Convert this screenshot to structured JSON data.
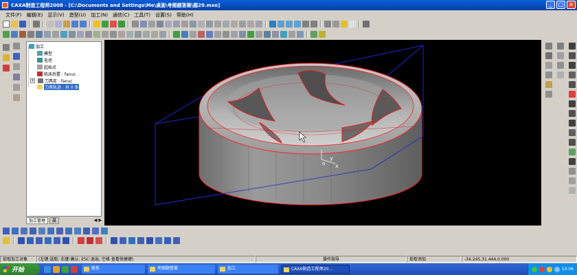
{
  "window": {
    "title": "CAXA制造工程师2008  - [C:\\Documents and Settings\\Me\\桌面\\考图题答案\\题29.mxe]",
    "minimize": "_",
    "maximize": "□",
    "close": "×"
  },
  "menu": [
    "文件(F)",
    "编辑(E)",
    "显示(V)",
    "造型(U)",
    "加工(N)",
    "通信(C)",
    "工具(T)",
    "设置(S)",
    "帮助(H)"
  ],
  "tree": {
    "root": "加工",
    "items": [
      {
        "label": "模型",
        "icon": "model-icon"
      },
      {
        "label": "毛坯",
        "icon": "blank-icon"
      },
      {
        "label": "起始点",
        "icon": "start-point-icon"
      },
      {
        "label": "机床后置 : fanuc",
        "icon": "machine-post-icon"
      },
      {
        "label": "刀具库 : fanuc",
        "icon": "tool-library-icon"
      },
      {
        "label": "刀具轨迹 : 共 0 条",
        "icon": "toolpath-folder-icon",
        "selected": true
      }
    ],
    "expander": "+"
  },
  "tree_tabs": [
    "加工管理",
    "属"
  ],
  "viewport": {
    "axis_labels": [
      "y",
      "x",
      "o"
    ],
    "background": "#000000",
    "model_color": "#a8a8a8",
    "edge_color": "#ff2020",
    "bbox_color": "#1e2ac8"
  },
  "status": {
    "prompt": "拾取加工对象",
    "help": "(左键:选取; 右键:确认; ESC:退出; 空格 查看快捷键)",
    "command": "操作指导",
    "mode": "拾取添加",
    "coordinates": "-34.245,31.444,0.000"
  },
  "taskbar": {
    "start": "开始",
    "tasks": [
      "联系",
      "考图题答案",
      "加工",
      "CAXA制造工程师20..."
    ],
    "active_task": 3,
    "time": "14:06"
  }
}
